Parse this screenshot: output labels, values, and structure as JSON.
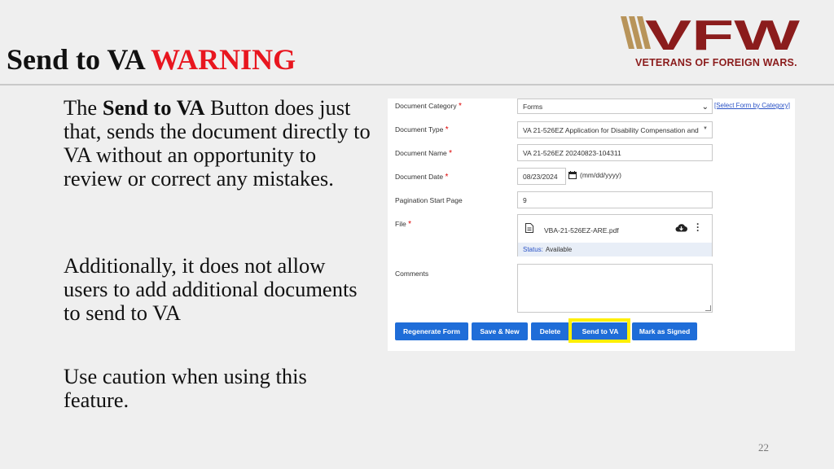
{
  "slide": {
    "title_main": "Send to VA",
    "title_warning": "WARNING",
    "page_number": "22",
    "paragraph1_pre": "The ",
    "paragraph1_bold": "Send to VA",
    "paragraph1_post": " Button does just that, sends the document directly to VA without an opportunity to review or correct any mistakes.",
    "paragraph2": "Additionally, it does not allow users to add additional documents to send to VA",
    "paragraph3": "Use caution when using this feature."
  },
  "logo": {
    "text": "VFW",
    "subtitle": "VETERANS OF FOREIGN WARS.",
    "color": "#8b1c1c",
    "stripe_color": "#b8945a"
  },
  "form": {
    "labels": {
      "document_category": "Document Category",
      "document_type": "Document Type",
      "document_name": "Document Name",
      "document_date": "Document Date",
      "pagination_start_page": "Pagination Start Page",
      "file": "File",
      "comments": "Comments"
    },
    "required_mark": "*",
    "document_category_value": "Forms",
    "select_form_link": "[Select Form by Category]",
    "document_type_value": "VA 21-526EZ Application for Disability Compensation and ...",
    "document_name_value": "VA 21-526EZ 20240823-104311",
    "document_date_value": "08/23/2024",
    "date_format_hint": "(mm/dd/yyyy)",
    "pagination_start_value": "9",
    "file_name": "VBA-21-526EZ-ARE.pdf",
    "file_status_label": "Status:",
    "file_status_value": "Available",
    "comments_value": ""
  },
  "buttons": {
    "regenerate": "Regenerate Form",
    "save_new": "Save & New",
    "delete": "Delete",
    "send_to_va": "Send to VA",
    "mark_signed": "Mark as Signed"
  },
  "colors": {
    "warning": "#e8161f",
    "button_blue": "#1f6dd8",
    "highlight": "#ffef00",
    "link": "#2a52c6"
  }
}
